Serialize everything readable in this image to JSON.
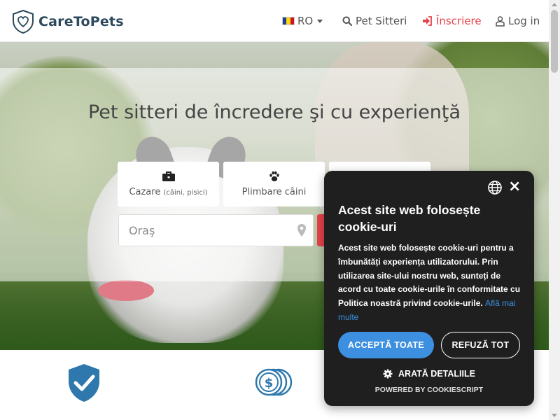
{
  "header": {
    "logo_text": "CareToPets",
    "lang": "RO",
    "nav_sitters": "Pet Sitteri",
    "nav_signup": "Înscriere",
    "nav_login": "Log in"
  },
  "hero": {
    "title": "Pet sitteri de încredere şi cu experienţă",
    "services": [
      {
        "label": "Cazare",
        "sub": "(câini, pisici)",
        "icon": "briefcase-icon"
      },
      {
        "label": "Plimbare câini",
        "sub": "",
        "icon": "paw-icon"
      }
    ],
    "city_placeholder": "Oraş"
  },
  "cookie": {
    "title": "Acest site web folosește cookie-uri",
    "body": "Acest site web folosește cookie-uri pentru a îmbunătăți experiența utilizatorului. Prin utilizarea site-ului nostru web, sunteți de acord cu toate cookie-urile în conformitate cu Politica noastră privind cookie-urile.",
    "link": "Află mai multe",
    "accept": "ACCEPTĂ TOATE",
    "refuse": "REFUZĂ TOT",
    "details": "ARATĂ DETALIILE",
    "powered": "POWERED BY COOKIESCRIPT"
  },
  "colors": {
    "brand": "#2d4a5c",
    "accent_red": "#e8434d",
    "accept_blue": "#3d8fe0",
    "dialog_bg": "#1f1f1f",
    "shield_blue": "#2f78ad"
  }
}
